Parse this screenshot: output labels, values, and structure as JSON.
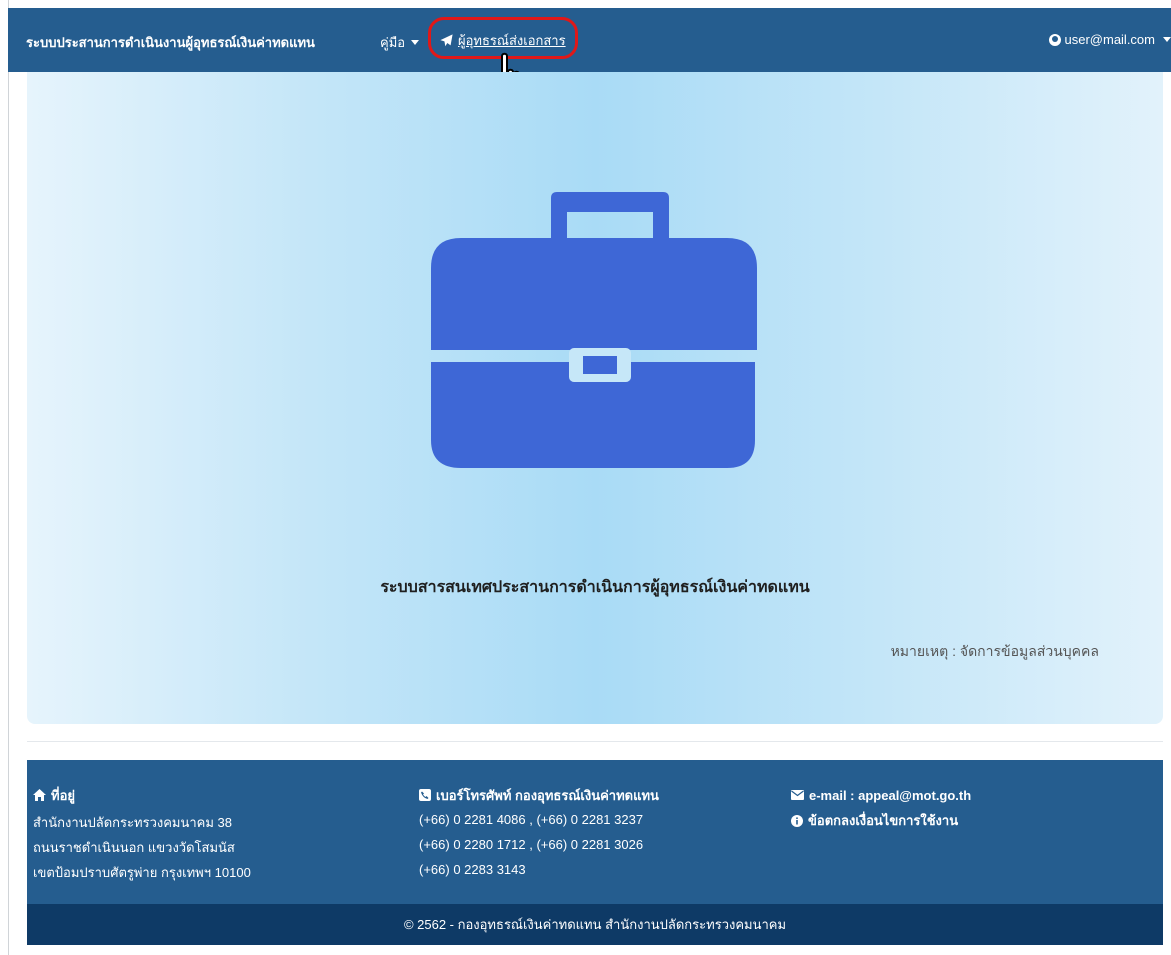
{
  "navbar": {
    "brand": "ระบบประสานการดำเนินงานผู้อุทธรณ์เงินค่าทดแทน",
    "manual": "คู่มือ",
    "send_docs": "ผู้อุทธรณ์ส่งเอกสาร",
    "user": "user@mail.com"
  },
  "hero": {
    "icon": "briefcase-icon",
    "title": "ระบบสารสนเทศประสานการดำเนินการผู้อุทธรณ์เงินค่าทดแทน",
    "note": "หมายเหตุ : จัดการข้อมูลส่วนบุคคล"
  },
  "footer": {
    "address_title": "ที่อยู่",
    "address_lines": [
      "สำนักงานปลัดกระทรวงคมนาคม 38",
      "ถนนราชดำเนินนอก แขวงวัดโสมนัส",
      "เขตป้อมปราบศัตรูพ่าย กรุงเทพฯ 10100"
    ],
    "phone_title": "เบอร์โทรศัพท์ กองอุทธรณ์เงินค่าทดแทน",
    "phone_lines": [
      "(+66) 0 2281 4086 , (+66) 0 2281 3237",
      "(+66) 0 2280 1712 , (+66) 0 2281 3026",
      "(+66) 0 2283 3143"
    ],
    "email": "e-mail : appeal@mot.go.th",
    "terms": "ข้อตกลงเงื่อนไขการใช้งาน",
    "copyright": "© 2562 - กองอุทธรณ์เงินค่าทดแทน สำนักงานปลัดกระทรวงคมนาคม"
  },
  "colors": {
    "navbar": "#255d8f",
    "footer_bottom": "#0e3a66",
    "briefcase": "#3e67d6",
    "highlight": "#e01818"
  }
}
